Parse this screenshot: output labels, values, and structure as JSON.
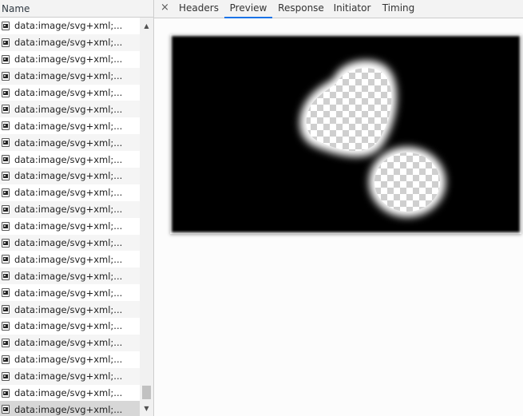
{
  "list": {
    "header": "Name",
    "row_label": "data:image/svg+xml;...",
    "rows": [
      "data:image/svg+xml;...",
      "data:image/svg+xml;...",
      "data:image/svg+xml;...",
      "data:image/svg+xml;...",
      "data:image/svg+xml;...",
      "data:image/svg+xml;...",
      "data:image/svg+xml;...",
      "data:image/svg+xml;...",
      "data:image/svg+xml;...",
      "data:image/svg+xml;...",
      "data:image/svg+xml;...",
      "data:image/svg+xml;...",
      "data:image/svg+xml;...",
      "data:image/svg+xml;...",
      "data:image/svg+xml;...",
      "data:image/svg+xml;...",
      "data:image/svg+xml;...",
      "data:image/svg+xml;...",
      "data:image/svg+xml;...",
      "data:image/svg+xml;...",
      "data:image/svg+xml;...",
      "data:image/svg+xml;...",
      "data:image/svg+xml;...",
      "data:image/svg+xml;..."
    ],
    "selected_index": 23
  },
  "tabs": {
    "close": "×",
    "items": [
      {
        "label": "Headers"
      },
      {
        "label": "Preview"
      },
      {
        "label": "Response"
      },
      {
        "label": "Initiator"
      },
      {
        "label": "Timing"
      }
    ],
    "active": "Preview"
  },
  "preview": {
    "background_color": "#000000",
    "blob_color": "#ffffff",
    "checker_light": "#ffffff",
    "checker_dark": "#cfcfcf"
  },
  "icons": {
    "file": "image-file-icon",
    "close": "close-icon",
    "scroll_up": "scroll-up-arrow-icon",
    "scroll_down": "scroll-down-arrow-icon"
  }
}
